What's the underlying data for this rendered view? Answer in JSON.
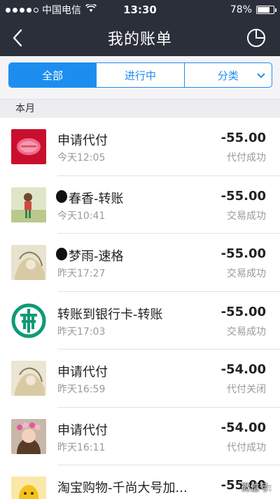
{
  "statusbar": {
    "carrier": "中国电信",
    "time": "13:30",
    "battery_text": "78%",
    "battery_level": 0.78
  },
  "navbar": {
    "title": "我的账单"
  },
  "tabs": {
    "all": "全部",
    "in_progress": "进行中",
    "category": "分类"
  },
  "section_title": "本月",
  "transactions": [
    {
      "title": "申请代付",
      "time": "今天12:05",
      "amount": "-55.00",
      "status": "代付成功"
    },
    {
      "title": "春香-转账",
      "time": "今天10:41",
      "amount": "-55.00",
      "status": "交易成功"
    },
    {
      "title": "梦雨-速格",
      "time": "昨天17:27",
      "amount": "-55.00",
      "status": "交易成功"
    },
    {
      "title": "转账到银行卡-转账",
      "time": "昨天17:03",
      "amount": "-55.00",
      "status": "交易成功"
    },
    {
      "title": "申请代付",
      "time": "昨天16:59",
      "amount": "-54.00",
      "status": "代付关闭"
    },
    {
      "title": "申请代付",
      "time": "昨天16:11",
      "amount": "-54.00",
      "status": "代付成功"
    },
    {
      "title": "淘宝购物-千尚大号加...",
      "time": "",
      "amount": "-55.00",
      "status": ""
    }
  ],
  "watermark": "微信号:"
}
